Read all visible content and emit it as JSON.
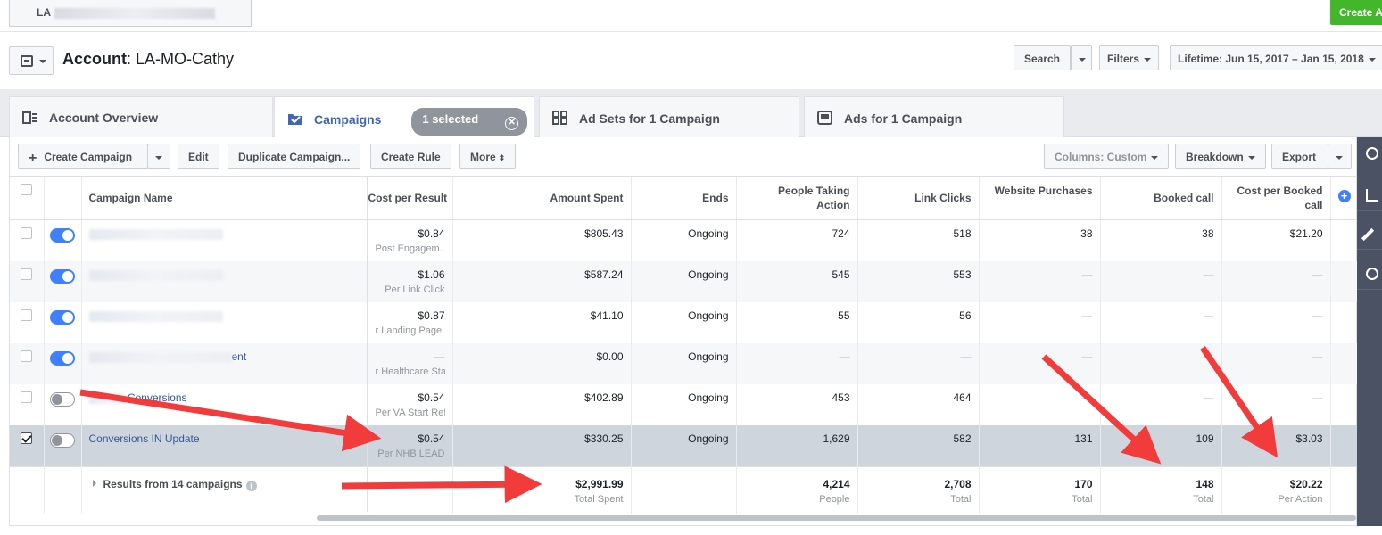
{
  "topbar": {
    "account_tab": "LA",
    "create_ad": "Create A"
  },
  "header": {
    "account_label": "Account",
    "account_name": "LA-MO-Cathy",
    "search": "Search",
    "filters": "Filters",
    "date_range": "Lifetime: Jun 15, 2017 – Jan 15, 2018"
  },
  "tabs": {
    "overview": "Account Overview",
    "campaigns": "Campaigns",
    "selected": "1 selected",
    "adsets": "Ad Sets for 1 Campaign",
    "ads": "Ads for 1 Campaign"
  },
  "toolbar": {
    "create": "Create Campaign",
    "edit": "Edit",
    "duplicate": "Duplicate Campaign...",
    "rule": "Create Rule",
    "more": "More",
    "columns": "Columns: Custom",
    "breakdown": "Breakdown",
    "export": "Export"
  },
  "columns": {
    "name": "Campaign Name",
    "cost_per_result": "Cost per Result",
    "amount_spent": "Amount Spent",
    "ends": "Ends",
    "people_taking_action": "People Taking Action",
    "link_clicks": "Link Clicks",
    "website_purchases": "Website Purchases",
    "booked_call": "Booked call",
    "cost_per_booked_call": "Cost per Booked call"
  },
  "rows": [
    {
      "name": "",
      "cpr": "$0.84",
      "cpr_sub": "Post Engagem...",
      "spent": "$805.43",
      "ends": "Ongoing",
      "people": "724",
      "clicks": "518",
      "purchases": "38",
      "booked": "38",
      "cost_booked": "$21.20"
    },
    {
      "name": "",
      "cpr": "$1.06",
      "cpr_sub": "Per Link Click",
      "spent": "$587.24",
      "ends": "Ongoing",
      "people": "545",
      "clicks": "553",
      "purchases": "—",
      "booked": "—",
      "cost_booked": "—"
    },
    {
      "name": "",
      "cpr": "$0.87",
      "cpr_sub": "r Landing Page ...",
      "spent": "$41.10",
      "ends": "Ongoing",
      "people": "55",
      "clicks": "56",
      "purchases": "—",
      "booked": "—",
      "cost_booked": "—"
    },
    {
      "name": "ent",
      "cpr": "—",
      "cpr_sub": "r Healthcare Start",
      "spent": "$0.00",
      "ends": "Ongoing",
      "people": "—",
      "clicks": "—",
      "purchases": "—",
      "booked": "—",
      "cost_booked": "—"
    },
    {
      "name": "Conversions",
      "cpr": "$0.54",
      "cpr_sub": "Per VA Start Refi",
      "spent": "$402.89",
      "ends": "Ongoing",
      "people": "453",
      "clicks": "464",
      "purchases": "—",
      "booked": "—",
      "cost_booked": "—"
    },
    {
      "name": "Conversions IN Update",
      "cpr": "$0.54",
      "cpr_sub": "Per NHB LEAD",
      "spent": "$330.25",
      "ends": "Ongoing",
      "people": "1,629",
      "clicks": "582",
      "purchases": "131",
      "booked": "109",
      "cost_booked": "$3.03"
    }
  ],
  "summary": {
    "label": "Results from 14 campaigns",
    "spent": "$2,991.99",
    "spent_sub": "Total Spent",
    "people": "4,214",
    "people_sub": "People",
    "clicks": "2,708",
    "clicks_sub": "Total",
    "purchases": "170",
    "purchases_sub": "Total",
    "booked": "148",
    "booked_sub": "Total",
    "cost_booked": "$20.22",
    "cost_booked_sub": "Per Action"
  },
  "colors": {
    "accent": "#4267b2",
    "toggle_on": "#4080ff",
    "arrow": "#f23b3b",
    "create_green": "#42b72a"
  }
}
